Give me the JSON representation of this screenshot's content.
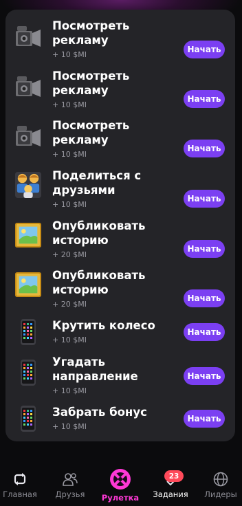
{
  "tasks": [
    {
      "icon": "video-camera-icon",
      "title": "Посмотреть рекламу",
      "reward": "+ 10 $MI",
      "button": "Начать"
    },
    {
      "icon": "video-camera-icon",
      "title": "Посмотреть рекламу",
      "reward": "+ 10 $MI",
      "button": "Начать"
    },
    {
      "icon": "video-camera-icon",
      "title": "Посмотреть рекламу",
      "reward": "+ 10 $MI",
      "button": "Начать"
    },
    {
      "icon": "family-icon",
      "title": "Поделиться с друзьями",
      "reward": "+ 10 $MI",
      "button": "Начать"
    },
    {
      "icon": "framed-picture-icon",
      "title": "Опубликовать историю",
      "reward": "+ 20 $MI",
      "button": "Начать"
    },
    {
      "icon": "framed-picture-icon",
      "title": "Опубликовать историю",
      "reward": "+ 20 $MI",
      "button": "Начать"
    },
    {
      "icon": "mobile-phone-icon",
      "title": "Крутить колесо",
      "reward": "+ 10 $MI",
      "button": "Начать"
    },
    {
      "icon": "mobile-phone-icon",
      "title": "Угадать направление",
      "reward": "+ 10 $MI",
      "button": "Начать"
    },
    {
      "icon": "mobile-phone-icon",
      "title": "Забрать бонус",
      "reward": "+ 10 $MI",
      "button": "Начать"
    }
  ],
  "nav": {
    "items": [
      {
        "label": "Главная",
        "icon": "swap-icon"
      },
      {
        "label": "Друзья",
        "icon": "friends-icon"
      },
      {
        "label": "Рулетка",
        "icon": "roulette-icon",
        "active": true
      },
      {
        "label": "Задания",
        "icon": "tasks-icon",
        "badge": "23"
      },
      {
        "label": "Лидеры",
        "icon": "globe-icon"
      }
    ]
  },
  "colors": {
    "background": "#0b0b0d",
    "panel": "#242428",
    "button": "#7b3ff2",
    "active_nav": "#ff38d6",
    "badge": "#ff4a5a"
  }
}
